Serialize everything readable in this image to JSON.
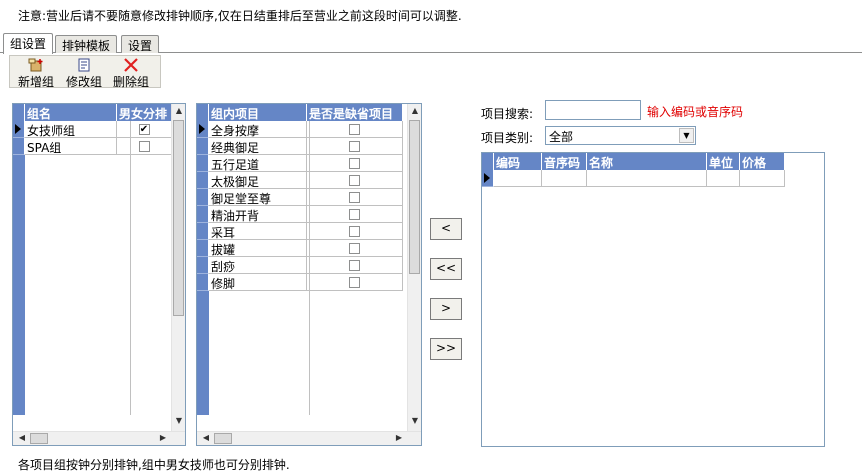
{
  "notice": "注意:营业后请不要随意修改排钟顺序,仅在日结重排后至营业之前这段时间可以调整.",
  "tabs": [
    "组设置",
    "排钟模板",
    "设置"
  ],
  "toolbar": {
    "new_group": "新增组",
    "edit_group": "修改组",
    "delete_group": "删除组"
  },
  "group_grid": {
    "headers": [
      "组名",
      "男女分排"
    ],
    "rows": [
      {
        "name": "女技师组",
        "checked": "✔"
      },
      {
        "name": "SPA组",
        "checked": ""
      }
    ]
  },
  "item_grid": {
    "headers": [
      "组内项目",
      "是否是缺省项目"
    ],
    "rows": [
      {
        "name": "全身按摩"
      },
      {
        "name": "经典御足"
      },
      {
        "name": "五行足道"
      },
      {
        "name": "太极御足"
      },
      {
        "name": "御足堂至尊"
      },
      {
        "name": "精油开背"
      },
      {
        "name": "采耳"
      },
      {
        "name": "拔罐"
      },
      {
        "name": "刮痧"
      },
      {
        "name": "修脚"
      }
    ]
  },
  "transfer_buttons": [
    "<",
    "<<",
    ">",
    ">>"
  ],
  "search": {
    "label": "项目搜索:",
    "value": "",
    "hint": "输入编码或音序码"
  },
  "category": {
    "label": "项目类别:",
    "value": "全部"
  },
  "result_grid": {
    "headers": [
      "编码",
      "音序码",
      "名称",
      "单位",
      "价格"
    ]
  },
  "footer": "各项目组按钟分别排钟,组中男女技师也可分别排钟."
}
